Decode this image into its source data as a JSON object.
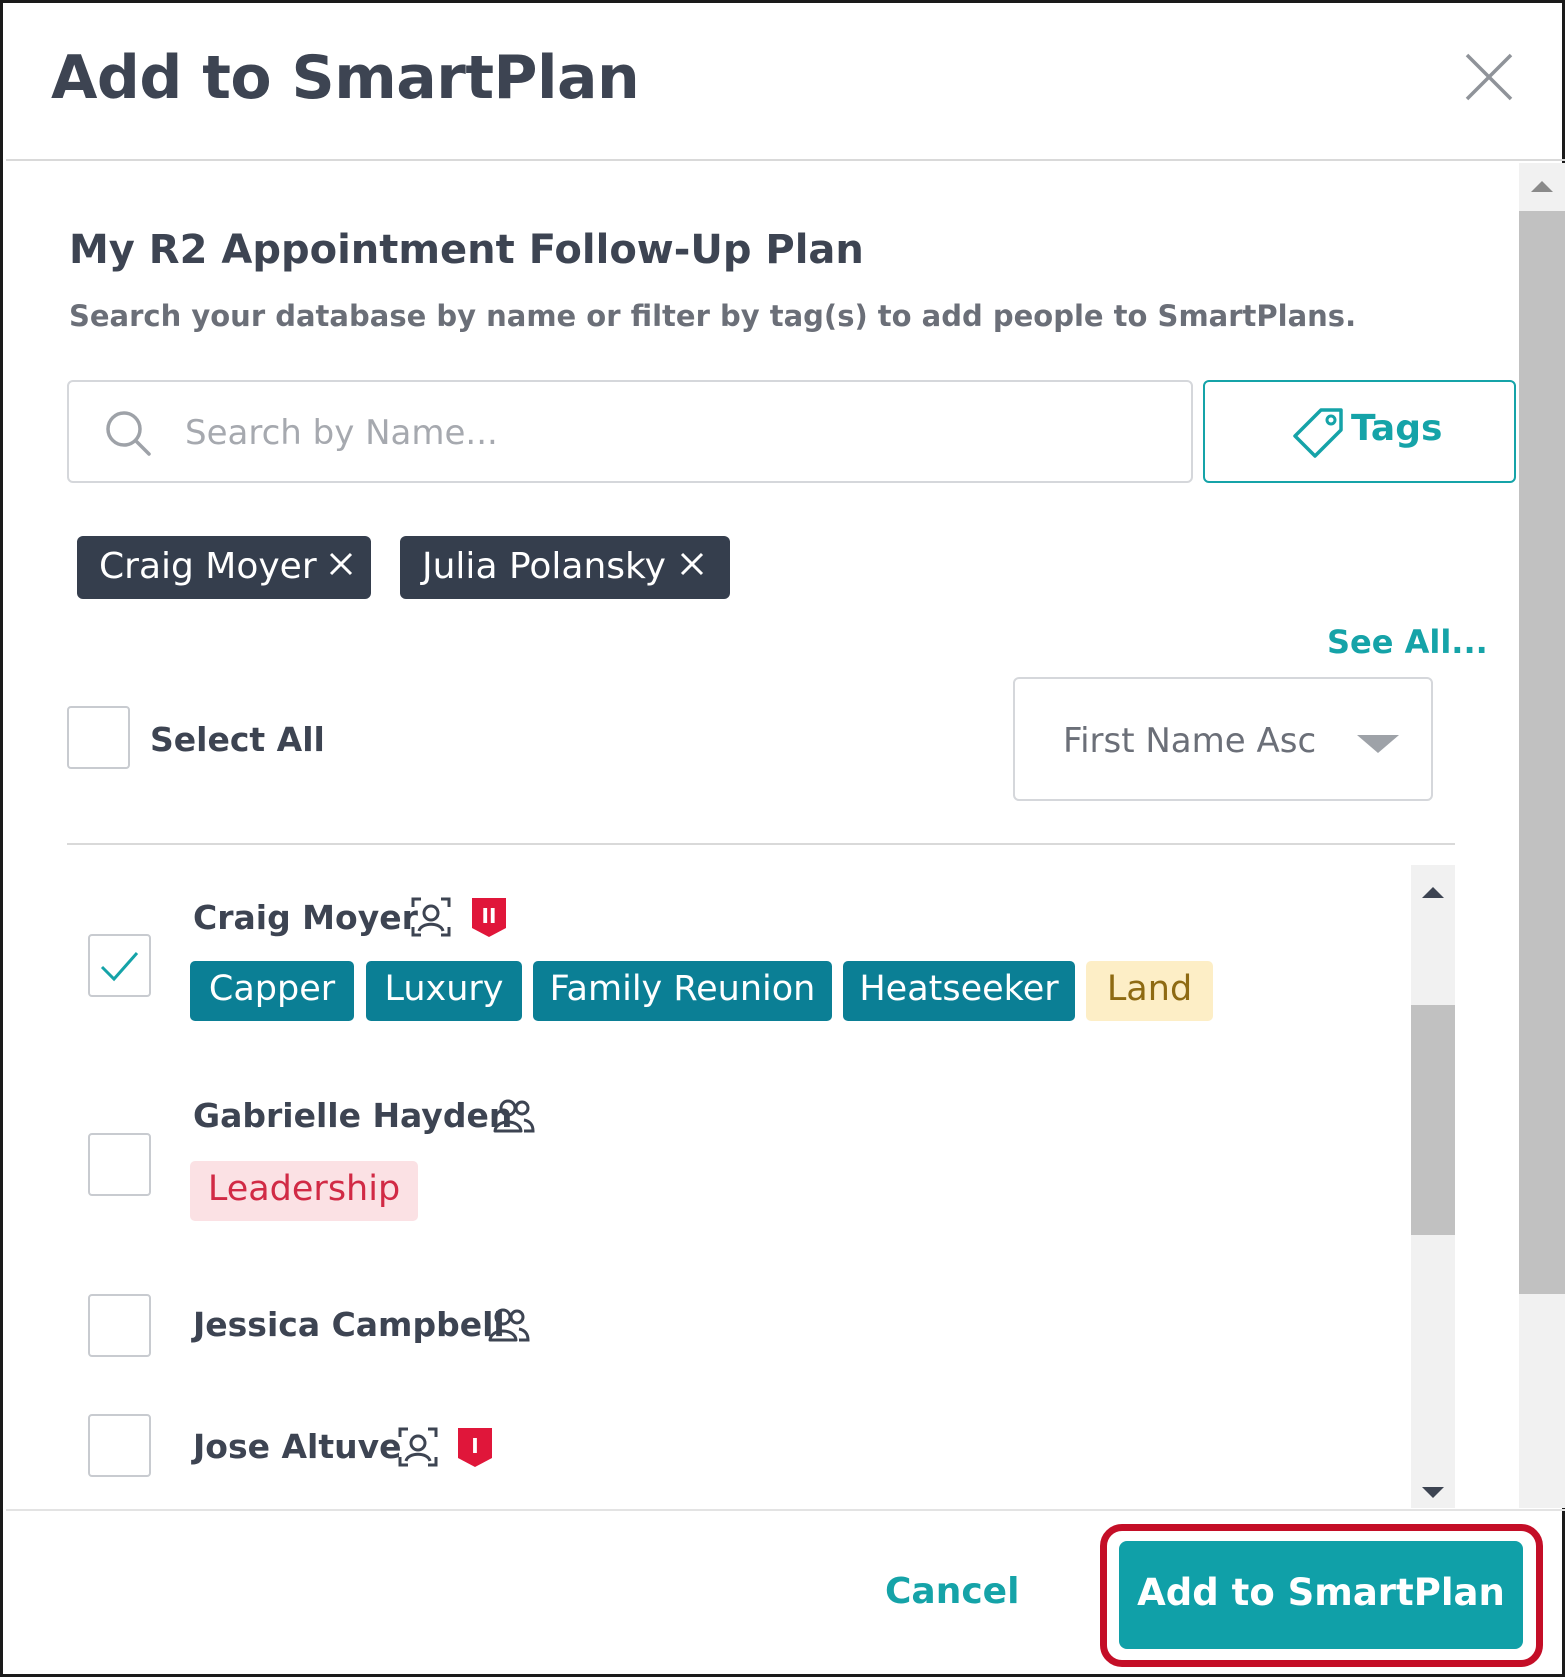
{
  "modal": {
    "title": "Add to SmartPlan",
    "plan_name": "My R2 Appointment Follow-Up Plan",
    "description": "Search your database by name or filter by tag(s) to add people to SmartPlans."
  },
  "search": {
    "placeholder": "Search by Name...",
    "value": ""
  },
  "tags_button": {
    "label": "Tags"
  },
  "selected_chips": [
    {
      "label": "Craig Moyer"
    },
    {
      "label": "Julia Polansky"
    }
  ],
  "see_all": "See All...",
  "select_all": {
    "label": "Select All",
    "checked": false
  },
  "sort": {
    "selected": "First Name Asc"
  },
  "people": [
    {
      "name": "Craig Moyer",
      "checked": true,
      "icon": "person-frame-icon",
      "tier": "II",
      "tags": [
        {
          "label": "Capper",
          "style": "teal"
        },
        {
          "label": "Luxury",
          "style": "teal"
        },
        {
          "label": "Family Reunion",
          "style": "teal"
        },
        {
          "label": "Heatseeker",
          "style": "teal"
        },
        {
          "label": "Land",
          "style": "yellow"
        }
      ]
    },
    {
      "name": "Gabrielle Hayden",
      "checked": false,
      "icon": "people-icon",
      "tags": [
        {
          "label": "Leadership",
          "style": "pink"
        }
      ]
    },
    {
      "name": "Jessica Campbell",
      "checked": false,
      "icon": "people-icon",
      "tags": []
    },
    {
      "name": "Jose Altuve",
      "checked": false,
      "icon": "person-frame-icon",
      "tier": "I",
      "tags": []
    }
  ],
  "footer": {
    "cancel_label": "Cancel",
    "submit_label": "Add to SmartPlan"
  },
  "colors": {
    "accent": "#15a3a8",
    "tag_teal": "#0b7f95",
    "chip_dark": "#353e4d",
    "tier_red": "#e0163a",
    "highlight_red": "#c40e27"
  }
}
